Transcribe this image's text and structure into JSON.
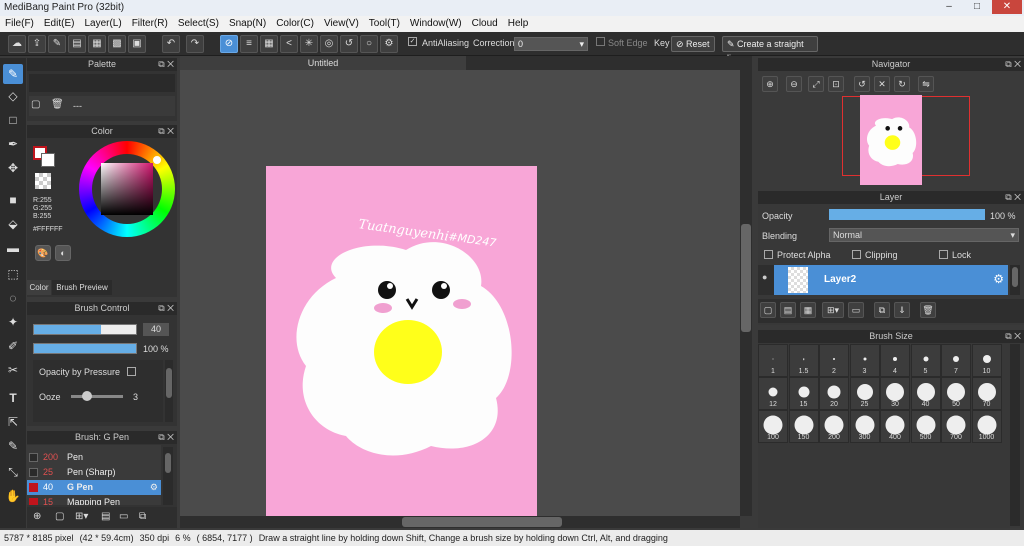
{
  "window": {
    "title": "MediBang Paint Pro (32bit)",
    "min": "–",
    "max": "□",
    "close": "✕"
  },
  "menu": [
    "File(F)",
    "Edit(E)",
    "Layer(L)",
    "Filter(R)",
    "Select(S)",
    "Snap(N)",
    "Color(C)",
    "View(V)",
    "Tool(T)",
    "Window(W)",
    "Cloud",
    "Help"
  ],
  "toolbar": {
    "antialiasing_label": "AntiAliasing",
    "correction_label": "Correction",
    "correction_value": "0",
    "soft_edge_label": "Soft Edge",
    "key_label": "Key",
    "reset_label": "Reset",
    "straight_line_label": "Create a straight line"
  },
  "palette": {
    "title": "Palette",
    "list_text": "---"
  },
  "color": {
    "title": "Color",
    "r": "R:255",
    "g": "G:255",
    "b": "B:255",
    "hex": "#FFFFFF",
    "tab_color": "Color",
    "tab_brush_preview": "Brush Preview",
    "primary": "#c0141c",
    "secondary": "#ffffff"
  },
  "brush_control": {
    "title": "Brush Control",
    "size_value": "40",
    "opacity_value": "100 %",
    "opacity_by_pressure": "Opacity by Pressure",
    "ooze_label": "Ooze",
    "ooze_value": "3",
    "size_fraction": 0.66,
    "opacity_fraction": 1.0,
    "ooze_fraction": 0.3
  },
  "brush_list": {
    "title": "Brush: G Pen",
    "items": [
      {
        "size": "200",
        "name": "Pen",
        "color": "#2a2a2a"
      },
      {
        "size": "25",
        "name": "Pen (Sharp)",
        "color": "#2a2a2a"
      },
      {
        "size": "40",
        "name": "G Pen",
        "color": "#c0141c"
      },
      {
        "size": "15",
        "name": "Mapping Pen",
        "color": "#c0141c"
      }
    ]
  },
  "canvas": {
    "tab_title": "Untitled",
    "signature": "Tuatnguyenhi",
    "tag": "#MD247"
  },
  "navigator": {
    "title": "Navigator"
  },
  "layer": {
    "title": "Layer",
    "opacity_label": "Opacity",
    "opacity_value": "100 %",
    "opacity_fraction": 1.0,
    "blending_label": "Blending",
    "blending_value": "Normal",
    "protect_alpha": "Protect Alpha",
    "clipping": "Clipping",
    "lock": "Lock",
    "layer_name": "Layer2"
  },
  "brush_size": {
    "title": "Brush Size",
    "sizes": [
      "1",
      "1.5",
      "2",
      "3",
      "4",
      "5",
      "7",
      "10",
      "12",
      "15",
      "20",
      "25",
      "30",
      "40",
      "50",
      "70",
      "100",
      "150",
      "200",
      "300",
      "400",
      "500",
      "700",
      "1000"
    ]
  },
  "status": {
    "dimensions": "5787 * 8185 pixel",
    "physical": "(42 * 59.4cm)",
    "dpi": "350 dpi",
    "zoom": "6 %",
    "coords": "( 6854, 7177 )",
    "hint": "Draw a straight line by holding down Shift, Change a brush size by holding down Ctrl, Alt, and dragging"
  }
}
